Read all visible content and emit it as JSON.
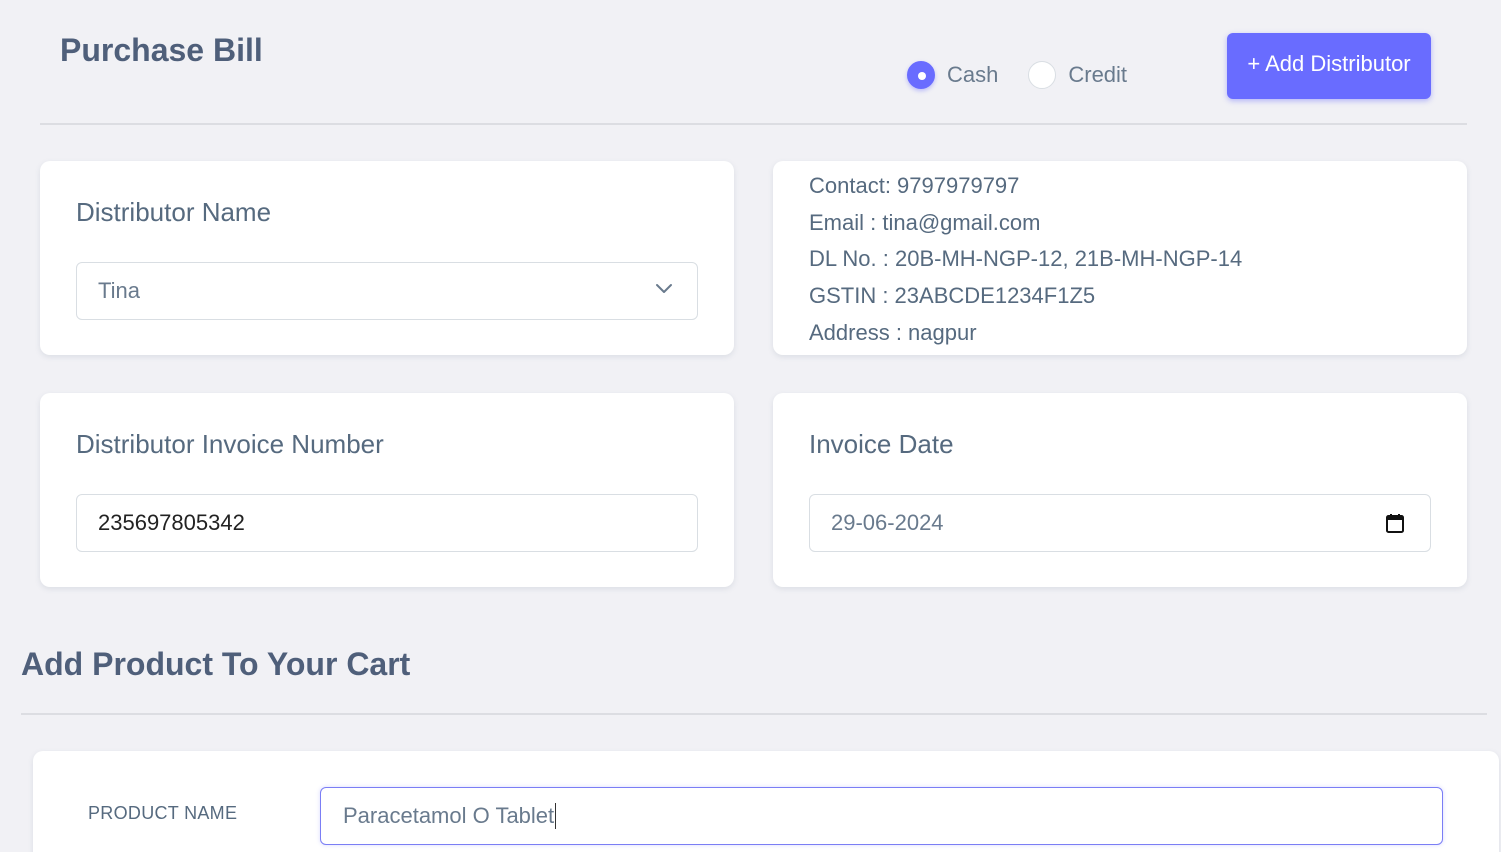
{
  "header": {
    "title": "Purchase Bill",
    "payment_options": [
      {
        "label": "Cash",
        "checked": true
      },
      {
        "label": "Credit",
        "checked": false
      }
    ],
    "add_distributor_label": "+ Add Distributor"
  },
  "distributor": {
    "label": "Distributor Name",
    "selected": "Tina"
  },
  "distributor_info": {
    "contact": "Contact: 9797979797",
    "email": "Email : tina@gmail.com",
    "dl_no": "DL No. : 20B-MH-NGP-12, 21B-MH-NGP-14",
    "gstin": "GSTIN : 23ABCDE1234F1Z5",
    "address": "Address : nagpur"
  },
  "invoice_number": {
    "label": "Distributor Invoice Number",
    "value": "235697805342"
  },
  "invoice_date": {
    "label": "Invoice Date",
    "value": "29-06-2024"
  },
  "cart": {
    "title": "Add Product To Your Cart",
    "product_label": "PRODUCT NAME",
    "product_value": "Paracetamol O Tablet"
  },
  "colors": {
    "accent": "#696cff",
    "text": "#566a7f",
    "background": "#f1f1f5"
  }
}
